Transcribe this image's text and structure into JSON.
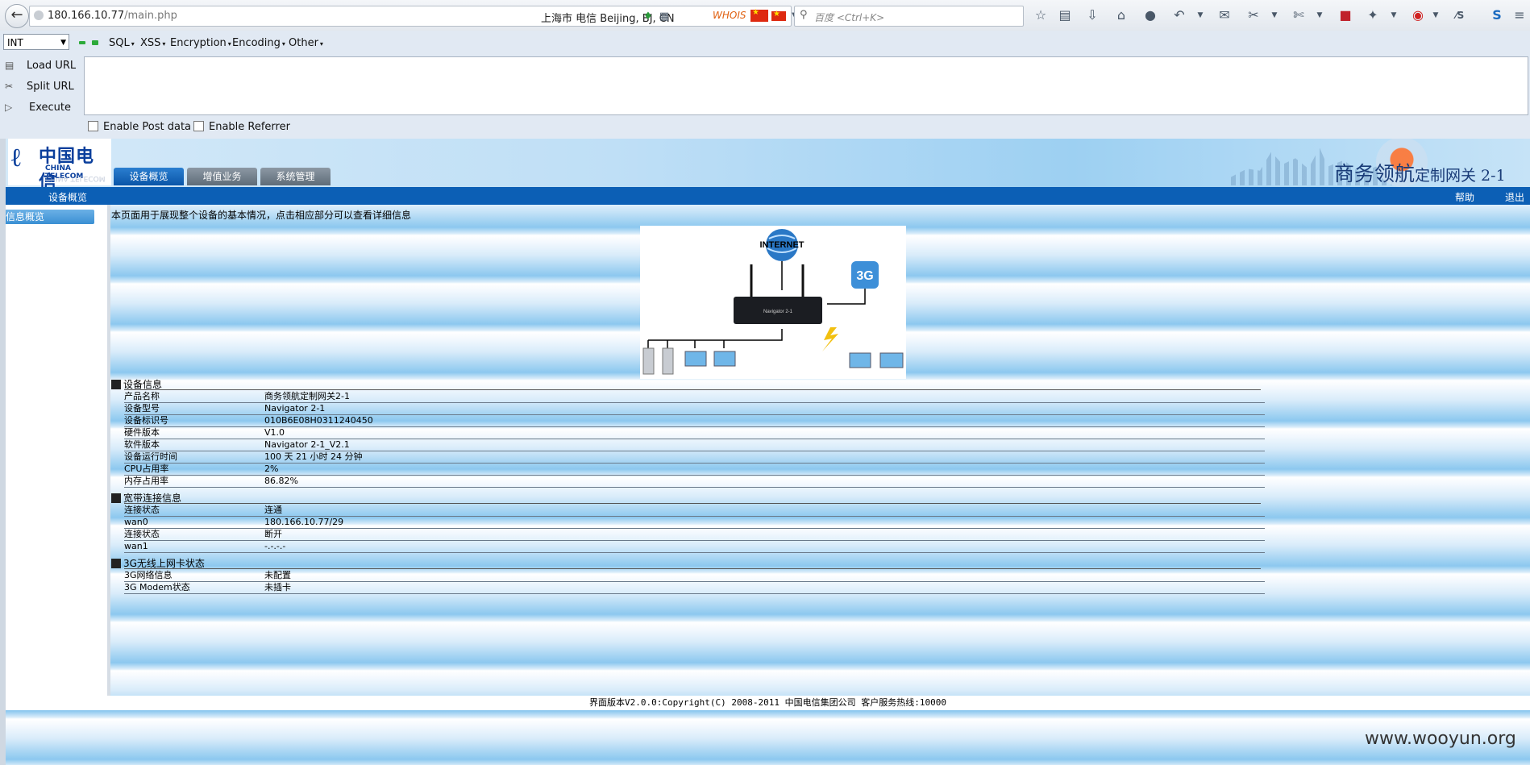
{
  "browser": {
    "url_host": "180.166.10.77",
    "url_path": "/main.php",
    "geo_info": "上海市 电信    Beijing, BJ, CN",
    "whois_label": "WHOIS",
    "search_placeholder": "百度 <Ctrl+K>"
  },
  "hackbar": {
    "select_value": "INT",
    "menus": [
      "SQL",
      "XSS",
      "Encryption",
      "Encoding",
      "Other"
    ],
    "actions": [
      "Load URL",
      "Split URL",
      "Execute"
    ],
    "checkboxes": [
      "Enable Post data",
      "Enable Referrer"
    ]
  },
  "router": {
    "logo_cn": "中国电信",
    "logo_en": "CHINA TELECOM",
    "title_big": "商务领航",
    "title_small": "定制网关  2-1",
    "tabs": [
      "设备概览",
      "增值业务",
      "系统管理"
    ],
    "nav_current": "设备概览",
    "nav_help": "帮助",
    "nav_logout": "退出",
    "sidebar_item": "信息概览",
    "intro": "本页面用于展现整个设备的基本情况，点击相应部分可以查看详细信息",
    "diagram": {
      "internet": "INTERNET",
      "badge_3g": "3G",
      "device_label": "Navigator 2-1"
    },
    "sections": [
      {
        "title": "设备信息",
        "rows": [
          {
            "k": "产品名称",
            "v": "商务领航定制网关2-1"
          },
          {
            "k": "设备型号",
            "v": "Navigator 2-1"
          },
          {
            "k": "设备标识号",
            "v": "010B6E08H0311240450"
          },
          {
            "k": "硬件版本",
            "v": "V1.0"
          },
          {
            "k": "软件版本",
            "v": "Navigator 2-1_V2.1"
          },
          {
            "k": "设备运行时间",
            "v": "100 天 21 小时 24 分钟"
          },
          {
            "k": "CPU占用率",
            "v": "2%"
          },
          {
            "k": "内存占用率",
            "v": "86.82%"
          }
        ]
      },
      {
        "title": "宽带连接信息",
        "rows": [
          {
            "k": "连接状态",
            "v": "连通"
          },
          {
            "k": "wan0",
            "v": "180.166.10.77/29"
          },
          {
            "k": "连接状态",
            "v": "断开"
          },
          {
            "k": "wan1",
            "v": "-.-.-.-"
          }
        ]
      },
      {
        "title": "3G无线上网卡状态",
        "rows": [
          {
            "k": "3G网络信息",
            "v": "未配置"
          },
          {
            "k": "3G Modem状态",
            "v": "未插卡"
          }
        ]
      }
    ],
    "footer": "界面版本V2.0.0:Copyright(C) 2008-2011 中国电信集团公司 客户服务热线:10000"
  },
  "watermark": "www.wooyun.org"
}
